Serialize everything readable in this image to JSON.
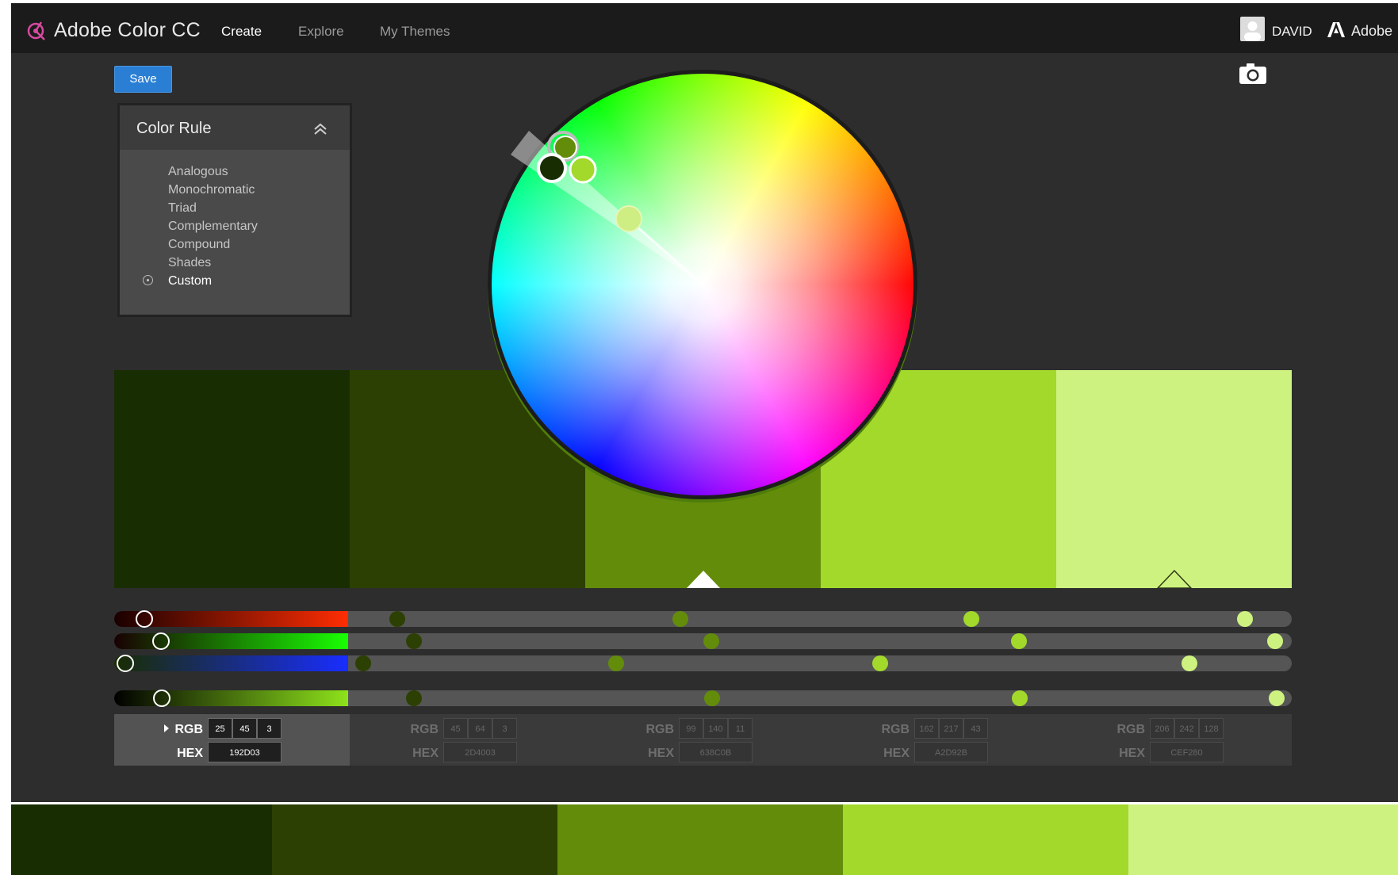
{
  "header": {
    "app_title": "Adobe Color CC",
    "nav": [
      "Create",
      "Explore",
      "My Themes"
    ],
    "active_nav": "Create",
    "user_name": "DAVID",
    "brand": "Adobe"
  },
  "toolbar": {
    "save_label": "Save"
  },
  "color_rule": {
    "title": "Color Rule",
    "items": [
      "Analogous",
      "Monochromatic",
      "Triad",
      "Complementary",
      "Compound",
      "Shades",
      "Custom"
    ],
    "selected": "Custom"
  },
  "swatches": [
    {
      "hex": "192D03",
      "rgb": [
        25,
        45,
        3
      ],
      "color": "#192D03"
    },
    {
      "hex": "2D4003",
      "rgb": [
        45,
        64,
        3
      ],
      "color": "#2D4003"
    },
    {
      "hex": "638C0B",
      "rgb": [
        99,
        140,
        11
      ],
      "color": "#638C0B"
    },
    {
      "hex": "A2D92B",
      "rgb": [
        162,
        217,
        43
      ],
      "color": "#A2D92B"
    },
    {
      "hex": "CEF280",
      "rgb": [
        206,
        242,
        128
      ],
      "color": "#CEF280"
    }
  ],
  "active_swatch_index": 0,
  "base_swatch_index": 2,
  "value_labels": {
    "rgb": "RGB",
    "hex": "HEX"
  },
  "colors": {
    "background": "#2d2d2d",
    "topbar": "#1b1b1b",
    "accent_blue": "#2a7fd4"
  }
}
